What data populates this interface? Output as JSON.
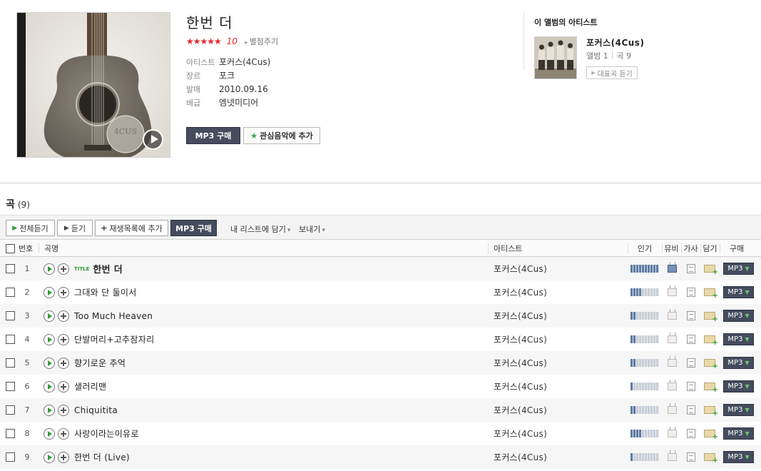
{
  "album": {
    "title": "한번 더",
    "stars": "★★★★★",
    "score": "10",
    "rate_link": "별점주기",
    "info": [
      {
        "label": "아티스트",
        "value": "포커스(4Cus)"
      },
      {
        "label": "장르",
        "value": "포크"
      },
      {
        "label": "발매",
        "value": "2010.09.16"
      },
      {
        "label": "배급",
        "value": "엠넷미디어"
      }
    ],
    "buy_label": "MP3 구매",
    "favorite_label": "관심음악에 추가",
    "cover_badge": "4CUS"
  },
  "artist_panel": {
    "heading": "이 앨범의 아티스트",
    "name": "포커스(4Cus)",
    "albums": "앨범 1",
    "songs": "곡 9",
    "rep_button": "대표곡 듣기"
  },
  "songs_section": {
    "heading": "곡",
    "count": "(9)"
  },
  "toolbar": {
    "play_all": "전체듣기",
    "play": "듣기",
    "add_playlist": "재생목록에 추가",
    "buy_mp3": "MP3 구매",
    "my_list": "내 리스트에 담기",
    "send": "보내기"
  },
  "table": {
    "headers": {
      "number": "번호",
      "title": "곡명",
      "artist": "아티스트",
      "popularity": "인기",
      "mv": "뮤비",
      "lyrics": "가사",
      "save": "담기",
      "buy": "구매"
    },
    "title_badge": "TITLE",
    "mp3_label": "MP3",
    "rows": [
      {
        "number": "1",
        "title": "한번 더",
        "artist": "포커스(4Cus)",
        "is_title": true,
        "popularity": 1.0,
        "mv": true
      },
      {
        "number": "2",
        "title": "그대와 단 둘이서",
        "artist": "포커스(4Cus)",
        "is_title": false,
        "popularity": 0.4,
        "mv": false
      },
      {
        "number": "3",
        "title": "Too Much Heaven",
        "artist": "포커스(4Cus)",
        "is_title": false,
        "popularity": 0.2,
        "mv": false
      },
      {
        "number": "4",
        "title": "단발머리+고추잠자리",
        "artist": "포커스(4Cus)",
        "is_title": false,
        "popularity": 0.2,
        "mv": false
      },
      {
        "number": "5",
        "title": "향기로운 추억",
        "artist": "포커스(4Cus)",
        "is_title": false,
        "popularity": 0.2,
        "mv": false
      },
      {
        "number": "6",
        "title": "샐러리맨",
        "artist": "포커스(4Cus)",
        "is_title": false,
        "popularity": 0.1,
        "mv": false
      },
      {
        "number": "7",
        "title": "Chiquitita",
        "artist": "포커스(4Cus)",
        "is_title": false,
        "popularity": 0.2,
        "mv": false
      },
      {
        "number": "8",
        "title": "사랑이라는이유로",
        "artist": "포커스(4Cus)",
        "is_title": false,
        "popularity": 0.4,
        "mv": false
      },
      {
        "number": "9",
        "title": "한번 더 (Live)",
        "artist": "포커스(4Cus)",
        "is_title": false,
        "popularity": 0.1,
        "mv": false
      }
    ]
  },
  "colors": {
    "accent_red": "#e8262b",
    "button_dark": "#454c5e",
    "play_green": "#2e9c37",
    "popularity_fill": "#5d7ca3"
  }
}
